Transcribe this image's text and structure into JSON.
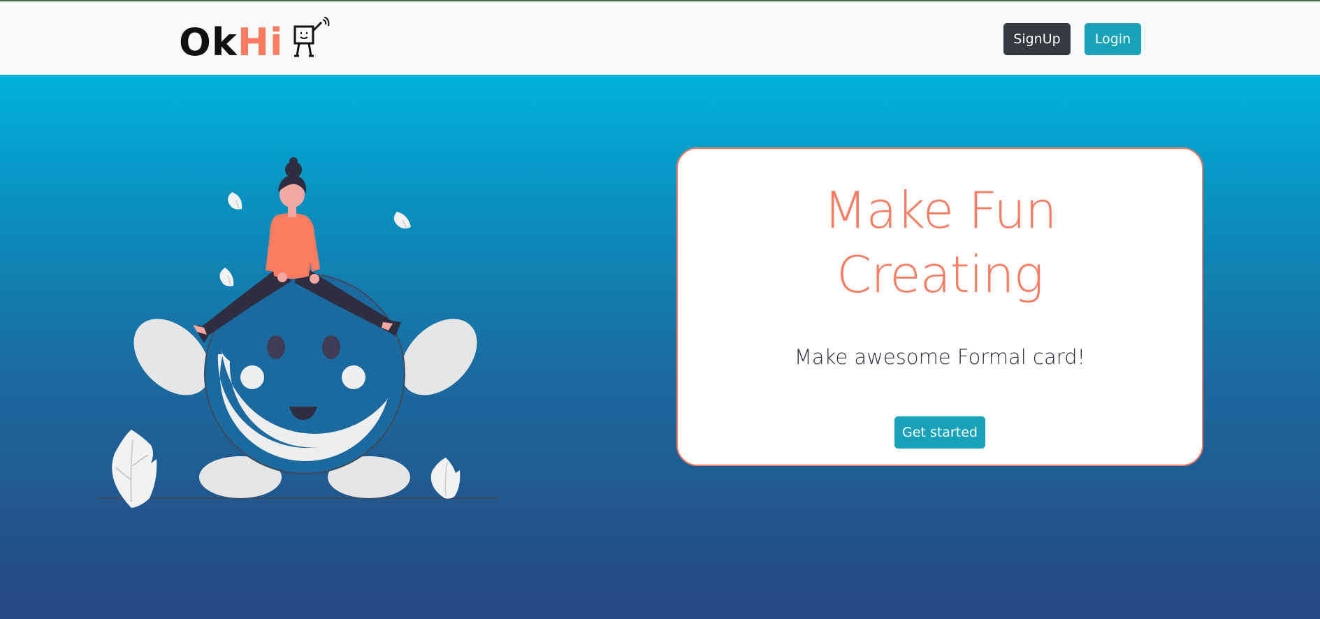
{
  "navbar": {
    "brand": {
      "ok": "Ok",
      "hi": "Hi"
    },
    "signup_label": "SignUp",
    "login_label": "Login"
  },
  "hero": {
    "title_line1": "Make Fun",
    "title_line2": "Creating",
    "subtitle": "Make awesome Formal card!",
    "cta_label": "Get started"
  },
  "colors": {
    "brand_accent": "#fa7b62",
    "signup_bg": "#343a40",
    "login_bg": "#17a2b8",
    "gradient_top": "#00b2d9",
    "gradient_bottom": "#264780"
  },
  "icons": {
    "logo_mascot": "robot-mascot-icon",
    "illustration": "girl-jumping-over-smiley-illustration"
  }
}
